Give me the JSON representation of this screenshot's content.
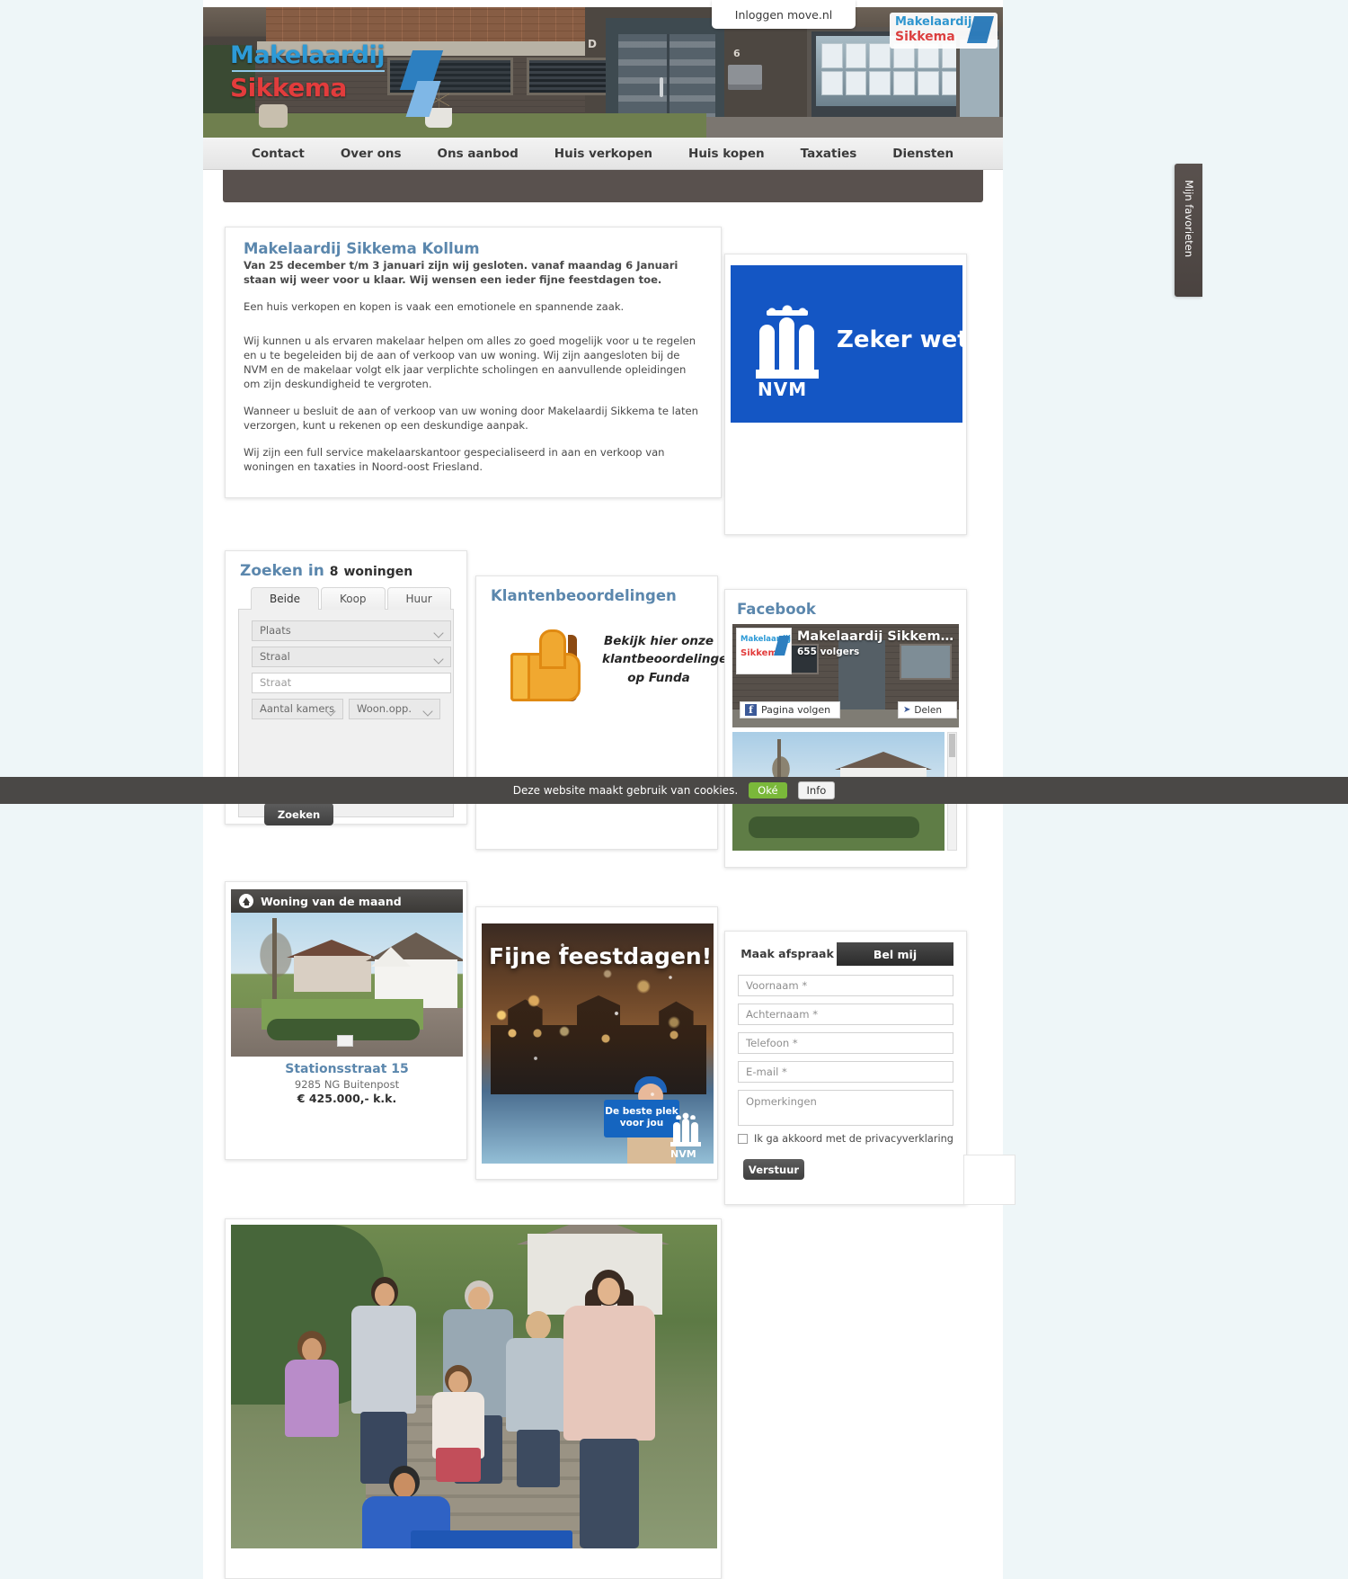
{
  "header": {
    "login_label": "Inloggen move.nl",
    "logo_top": "Makelaardij",
    "logo_bottom": "Sikkema",
    "door_letter": "D",
    "door_number": "6"
  },
  "nav": {
    "items": [
      {
        "label": "Contact"
      },
      {
        "label": "Over ons"
      },
      {
        "label": "Ons aanbod"
      },
      {
        "label": "Huis verkopen"
      },
      {
        "label": "Huis kopen"
      },
      {
        "label": "Taxaties"
      },
      {
        "label": "Diensten"
      }
    ]
  },
  "intro": {
    "title": "Makelaardij Sikkema Kollum",
    "notice": "Van 25 december t/m 3 januari zijn wij gesloten. vanaf maandag 6 Januari staan wij weer voor u klaar. Wij wensen een ieder fijne feestdagen toe.",
    "p1": "Een huis verkopen en kopen  is vaak een emotionele en spannende zaak.",
    "p2": "Wij kunnen u als ervaren makelaar helpen om alles zo goed mogelijk voor u te regelen en u te begeleiden bij de aan of verkoop van uw woning. Wij zijn aangesloten bij de NVM en de makelaar volgt elk jaar verplichte scholingen en aanvullende opleidingen om zijn deskundigheid te vergroten.",
    "p3": "Wanneer u besluit de aan of verkoop van uw woning door Makelaardij Sikkema te laten verzorgen, kunt u rekenen op een deskundige aanpak.",
    "p4": "Wij zijn een full service makelaarskantoor gespecialiseerd in aan en verkoop van woningen en taxaties in Noord-oost Friesland."
  },
  "nvm_banner": {
    "brand": "NVM",
    "claim": "Zeker wet",
    "color": "#1456c4"
  },
  "search": {
    "title_prefix": "Zoeken in",
    "count": "8",
    "title_suffix": "woningen",
    "tabs": [
      {
        "label": "Beide",
        "active": true
      },
      {
        "label": "Koop",
        "active": false
      },
      {
        "label": "Huur",
        "active": false
      }
    ],
    "plaats_placeholder": "Plaats",
    "straal_placeholder": "Straal",
    "straat_placeholder": "Straat",
    "kamers_placeholder": "Aantal kamers",
    "woonopp_placeholder": "Woon.opp.",
    "submit_label": "Zoeken"
  },
  "reviews": {
    "title": "Klantenbeoordelingen",
    "text": "Bekijk hier onze klantbeoordelingen op Funda"
  },
  "facebook": {
    "title": "Facebook",
    "page_name": "Makelaardij Sikkem…",
    "followers": "655 volgers",
    "follow_label": "Pagina volgen",
    "share_label": "Delen",
    "avatar_line1": "Makelaardij",
    "avatar_line2": "Sikkema"
  },
  "woning": {
    "header": "Woning van de maand",
    "address": "Stationsstraat 15",
    "zip_city": "9285 NG Buitenpost",
    "price": "€ 425.000,- k.k."
  },
  "xmas": {
    "headline": "Fijne feestdagen!",
    "sign_line1": "De beste plek",
    "sign_line2": "voor jou",
    "brand": "NVM"
  },
  "contact": {
    "tab_left": "Maak afspraak",
    "tab_right": "Bel mij",
    "voornaam_placeholder": "Voornaam *",
    "achternaam_placeholder": "Achternaam *",
    "telefoon_placeholder": "Telefoon *",
    "email_placeholder": "E-mail *",
    "opmerkingen_placeholder": "Opmerkingen",
    "privacy_label": "Ik ga akkoord met de privacyverklaring",
    "submit_label": "Verstuur"
  },
  "cookie": {
    "message": "Deze website maakt gebruik van cookies.",
    "ok_label": "Oké",
    "info_label": "Info"
  },
  "favorites": {
    "label": "Mijn favorieten"
  }
}
